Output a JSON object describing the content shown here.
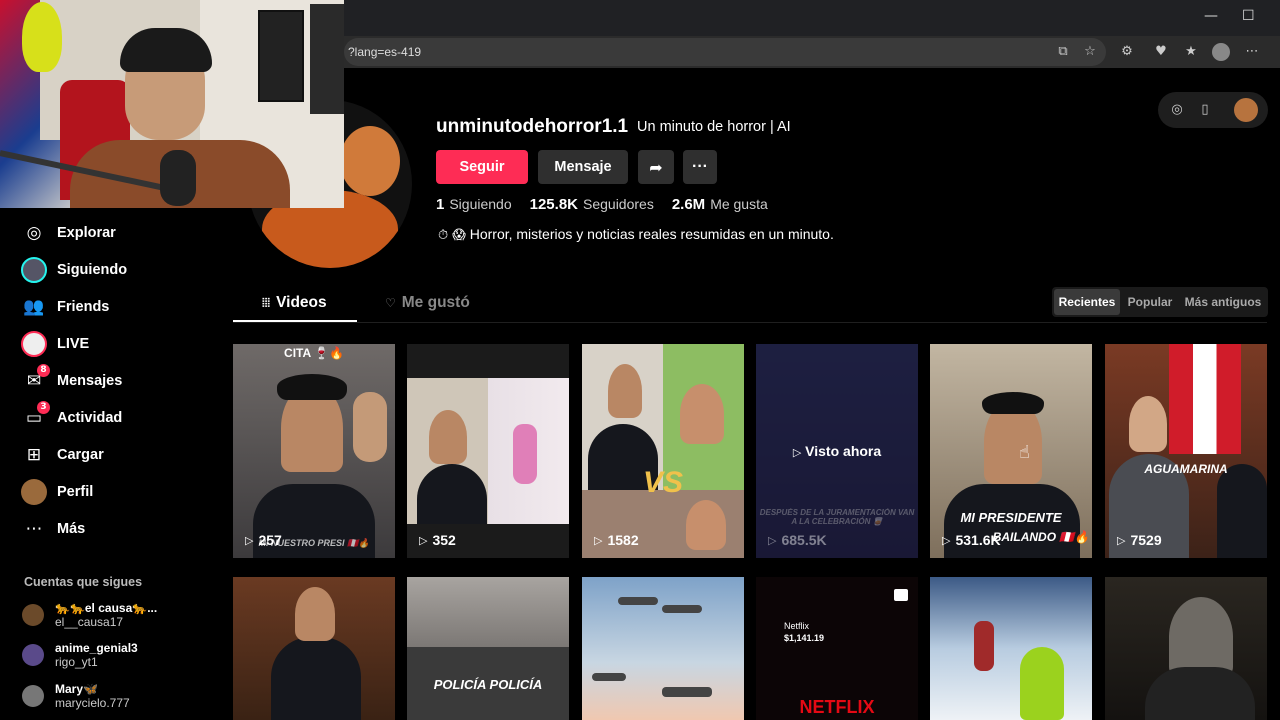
{
  "browser": {
    "url": "?lang=es-419",
    "minimize_icon": "minimize-icon",
    "maximize_icon": "maximize-icon"
  },
  "profile": {
    "username": "unminutodehorror1.1",
    "nickname": "Un minuto de horror | AI",
    "follow_label": "Seguir",
    "message_label": "Mensaje",
    "stats": [
      {
        "value": "1",
        "label": "Siguiendo"
      },
      {
        "value": "125.8K",
        "label": "Seguidores"
      },
      {
        "value": "2.6M",
        "label": "Me gusta"
      }
    ],
    "bio": "Horror, misterios y noticias reales resumidas en un minuto.",
    "bio_emoji": "⏱ 😱"
  },
  "sidebar": {
    "items": [
      {
        "label": "Explorar",
        "icon": "compass-icon"
      },
      {
        "label": "Siguiendo",
        "icon": "following-avatar-icon"
      },
      {
        "label": "Friends",
        "icon": "friends-icon"
      },
      {
        "label": "LIVE",
        "icon": "live-icon"
      },
      {
        "label": "Mensajes",
        "icon": "messages-icon",
        "badge": "8"
      },
      {
        "label": "Actividad",
        "icon": "activity-icon",
        "badge": "3"
      },
      {
        "label": "Cargar",
        "icon": "upload-icon"
      },
      {
        "label": "Perfil",
        "icon": "profile-icon"
      },
      {
        "label": "Más",
        "icon": "more-icon"
      }
    ],
    "following_title": "Cuentas que sigues",
    "accounts": [
      {
        "name": "🐆🐆el causa🐆...",
        "handle": "el__causa17"
      },
      {
        "name": "anime_genial3",
        "handle": "rigo_yt1"
      },
      {
        "name": "Mary🦋",
        "handle": "marycielo.777"
      }
    ]
  },
  "tabs": {
    "videos": "Videos",
    "liked": "Me gustó"
  },
  "sort": {
    "options": [
      "Recientes",
      "Popular",
      "Más antiguos"
    ],
    "active": "Recientes"
  },
  "videos": [
    {
      "views": "257",
      "caption_top": "CITA 🍷🔥",
      "caption_bottom": "MI NUESTRO PRESI 🇵🇪🔥"
    },
    {
      "views": "352"
    },
    {
      "views": "1582",
      "caption_mid": "VS"
    },
    {
      "views": "685.5K",
      "watched": "Visto ahora",
      "caption_mid": "DESPUÉS DE LA JURAMENTACIÓN VAN A LA CELEBRACIÓN 🥃"
    },
    {
      "views": "531.6K",
      "caption_mid": "MI PRESIDENTE",
      "caption_bottom": "BAILANDO 🇵🇪🔥"
    },
    {
      "views": "7529",
      "caption_mid": "AGUAMARINA"
    },
    {
      "views": ""
    },
    {
      "views": "",
      "caption_mid": "POLICÍA POLICÍA"
    },
    {
      "views": ""
    },
    {
      "views": "",
      "caption_top": "Netflix",
      "caption_amount": "$1,141.19",
      "caption_bottom": "NETFLIX"
    },
    {
      "views": ""
    },
    {
      "views": ""
    }
  ],
  "colors": {
    "accent": "#fe2c55",
    "background": "#000000",
    "button_dark": "#2f2f2f"
  }
}
